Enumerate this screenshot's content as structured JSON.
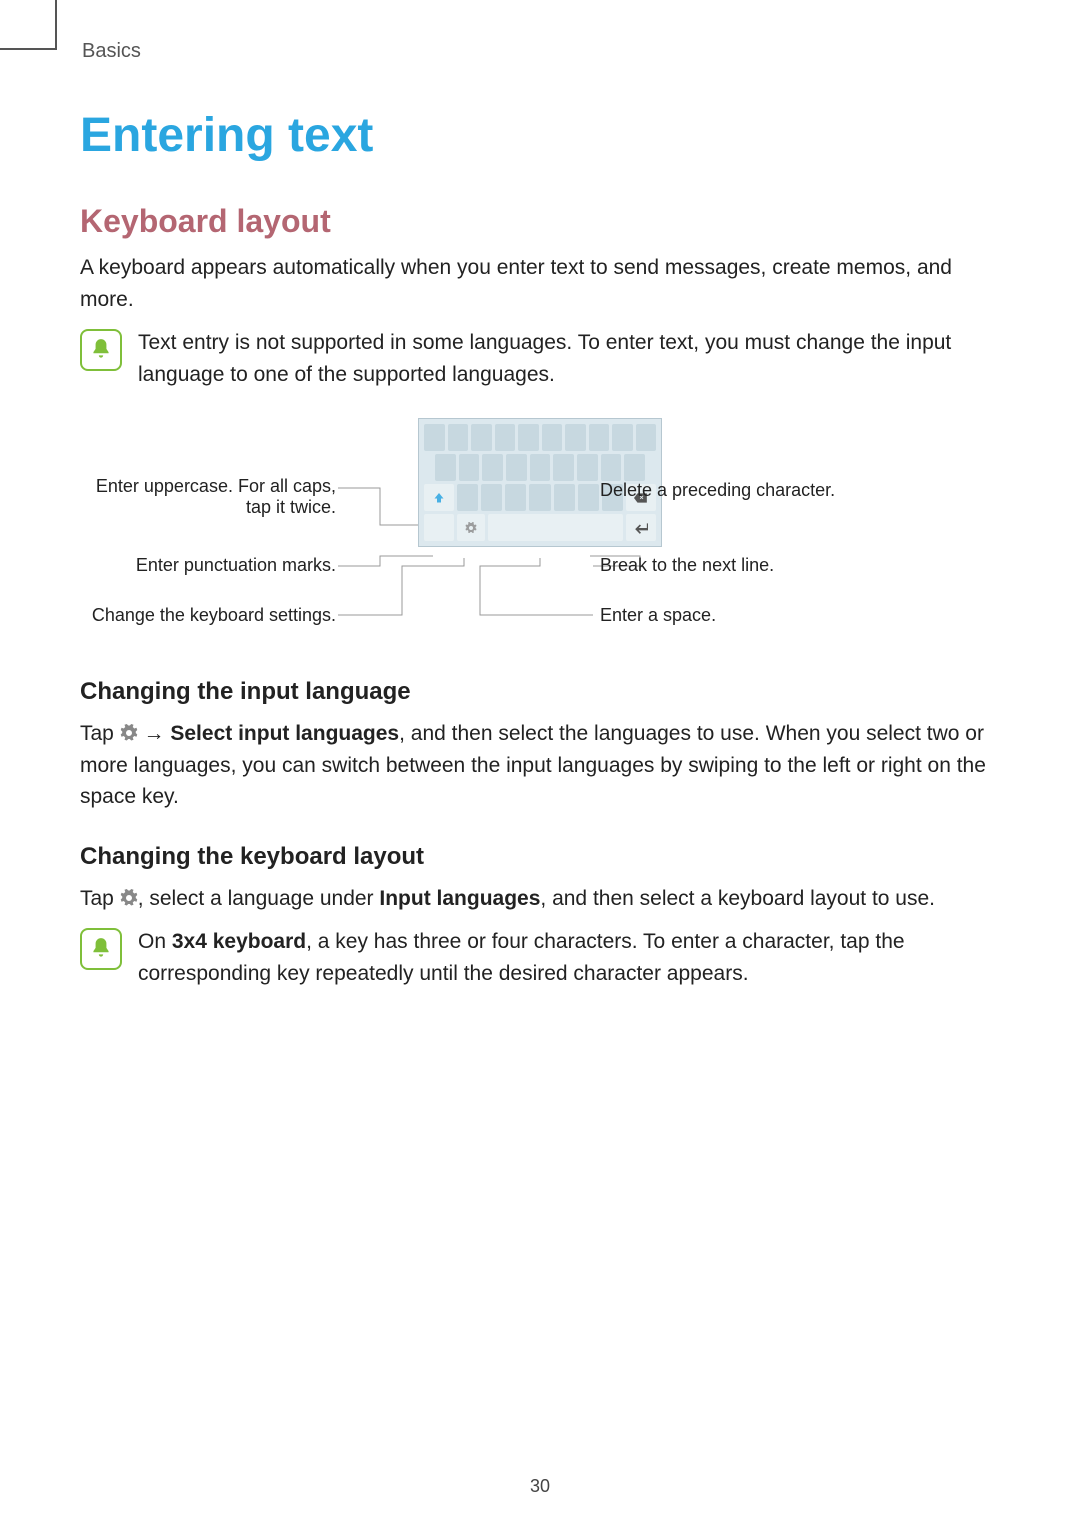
{
  "header": "Basics",
  "title": "Entering text",
  "section1": {
    "heading": "Keyboard layout",
    "intro": "A keyboard appears automatically when you enter text to send messages, create memos, and more.",
    "note": "Text entry is not supported in some languages. To enter text, you must change the input language to one of the supported languages."
  },
  "figure": {
    "callouts_left": [
      "Enter uppercase. For all caps, tap it twice.",
      "Enter punctuation marks.",
      "Change the keyboard settings."
    ],
    "callouts_right": [
      "Delete a preceding character.",
      "Break to the next line.",
      "Enter a space."
    ]
  },
  "section2": {
    "heading": "Changing the input language",
    "text_pre": "Tap ",
    "arrow": " → ",
    "bold": "Select input languages",
    "text_post": ", and then select the languages to use. When you select two or more languages, you can switch between the input languages by swiping to the left or right on the space key."
  },
  "section3": {
    "heading": "Changing the keyboard layout",
    "text_pre": "Tap ",
    "text_mid": ", select a language under ",
    "bold": "Input languages",
    "text_post": ", and then select a keyboard layout to use.",
    "note_pre": "On ",
    "note_bold": "3x4 keyboard",
    "note_post": ", a key has three or four characters. To enter a character, tap the corresponding key repeatedly until the desired character appears."
  },
  "page_number": "30"
}
